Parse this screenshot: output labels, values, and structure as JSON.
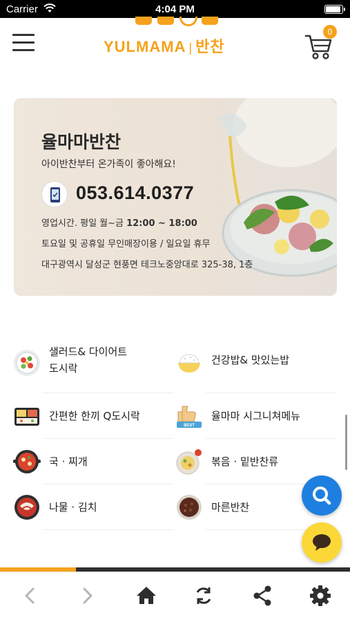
{
  "status_bar": {
    "carrier": "Carrier",
    "time": "4:04 PM"
  },
  "header": {
    "logo_text": "YULMAMA",
    "logo_korean": "반찬",
    "cart_count": "0",
    "brand_color": "#f5a21c"
  },
  "banner": {
    "title": "율마마반찬",
    "subtitle": "아이반찬부터 온가족이 좋아해요!",
    "phone": "053.614.0377",
    "hours_prefix": "영업시간. 평일 월~금 ",
    "hours_time": "12:00 ~ 18:00",
    "weekend_note": "토요일 및 공휴일 무인매장이용 / 일요일 휴무",
    "address": "대구광역시 달성군 현풍면 테크노중앙대로 325-38, 1층"
  },
  "categories": [
    {
      "line1": "샐러드& 다이어트",
      "line2": "도시락",
      "icon": "salad-bowl-icon"
    },
    {
      "line1": "건강밥& 맛있는밥",
      "line2": "",
      "icon": "rice-bowl-icon"
    },
    {
      "line1": "간편한 한끼 Q도시락",
      "line2": "",
      "icon": "lunchbox-icon"
    },
    {
      "line1": "율마마 시그니쳐메뉴",
      "line2": "",
      "icon": "best-thumbs-up-icon"
    },
    {
      "line1": "국 · 찌개",
      "line2": "",
      "icon": "soup-pot-icon"
    },
    {
      "line1": "볶음 · 밑반찬류",
      "line2": "",
      "icon": "side-dish-plate-icon"
    },
    {
      "line1": "나물 · 김치",
      "line2": "",
      "icon": "kimchi-bowl-icon"
    },
    {
      "line1": "마른반찬",
      "line2": "",
      "icon": "dried-dish-bowl-icon"
    }
  ],
  "floating": {
    "search_icon": "search-icon",
    "chat_icon": "chat-bubble-icon",
    "search_color": "#1e7fe0",
    "chat_color": "#fbd837"
  },
  "toolbar": {
    "items": [
      "back-arrow-icon",
      "forward-arrow-icon",
      "home-icon",
      "refresh-icon",
      "share-icon",
      "gear-icon"
    ]
  }
}
